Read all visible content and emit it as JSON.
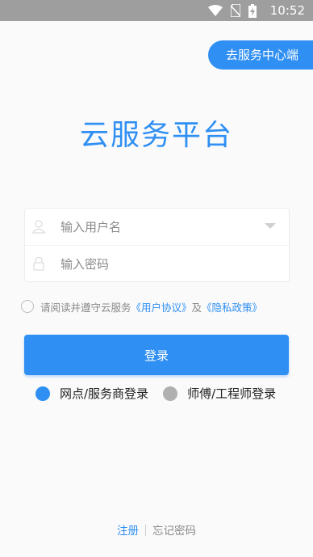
{
  "status_bar": {
    "time": "10:52"
  },
  "header": {
    "service_center_label": "去服务中心端"
  },
  "app_title": "云服务平台",
  "form": {
    "username_placeholder": "输入用户名",
    "password_placeholder": "输入密码"
  },
  "agreement": {
    "prefix": "请阅读并遵守云服务",
    "user_agreement": "《用户协议》",
    "and": "及",
    "privacy_policy": "《隐私政策》"
  },
  "login_label": "登录",
  "roles": [
    {
      "label": "网点/服务商登录",
      "selected": true,
      "color": "#2f8ff3"
    },
    {
      "label": "师傅/工程师登录",
      "selected": false,
      "color": "#b0b0b0"
    }
  ],
  "footer": {
    "register": "注册",
    "forgot_password": "忘记密码"
  },
  "colors": {
    "accent": "#2f8ff3",
    "status_bar": "#9e9e9e"
  }
}
